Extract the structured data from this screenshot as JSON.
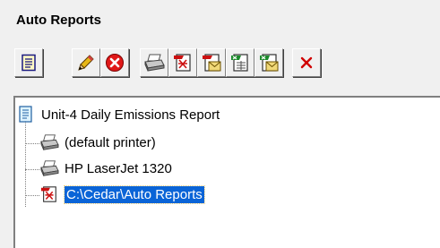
{
  "group_title": "Auto Reports",
  "toolbar": {
    "buttons": [
      {
        "icon": "report-properties-icon"
      },
      {
        "icon": "edit-pencil-icon"
      },
      {
        "icon": "delete-icon"
      },
      {
        "icon": "add-printer-icon"
      },
      {
        "icon": "add-pdf-icon"
      },
      {
        "icon": "add-pdf-email-icon"
      },
      {
        "icon": "add-excel-icon"
      },
      {
        "icon": "add-excel-email-icon"
      },
      {
        "icon": "remove-icon"
      }
    ]
  },
  "tree": {
    "root": {
      "label": "Unit-4 Daily Emissions Report",
      "icon": "report-document-icon"
    },
    "children": [
      {
        "label": "(default printer)",
        "icon": "printer-icon"
      },
      {
        "label": "HP LaserJet 1320",
        "icon": "printer-icon"
      },
      {
        "label": "C:\\Cedar\\Auto Reports",
        "icon": "pdf-folder-icon",
        "selected": true
      }
    ]
  },
  "colors": {
    "selection": "#0a64d7",
    "delete_red": "#e01818",
    "remove_red": "#d00000"
  }
}
